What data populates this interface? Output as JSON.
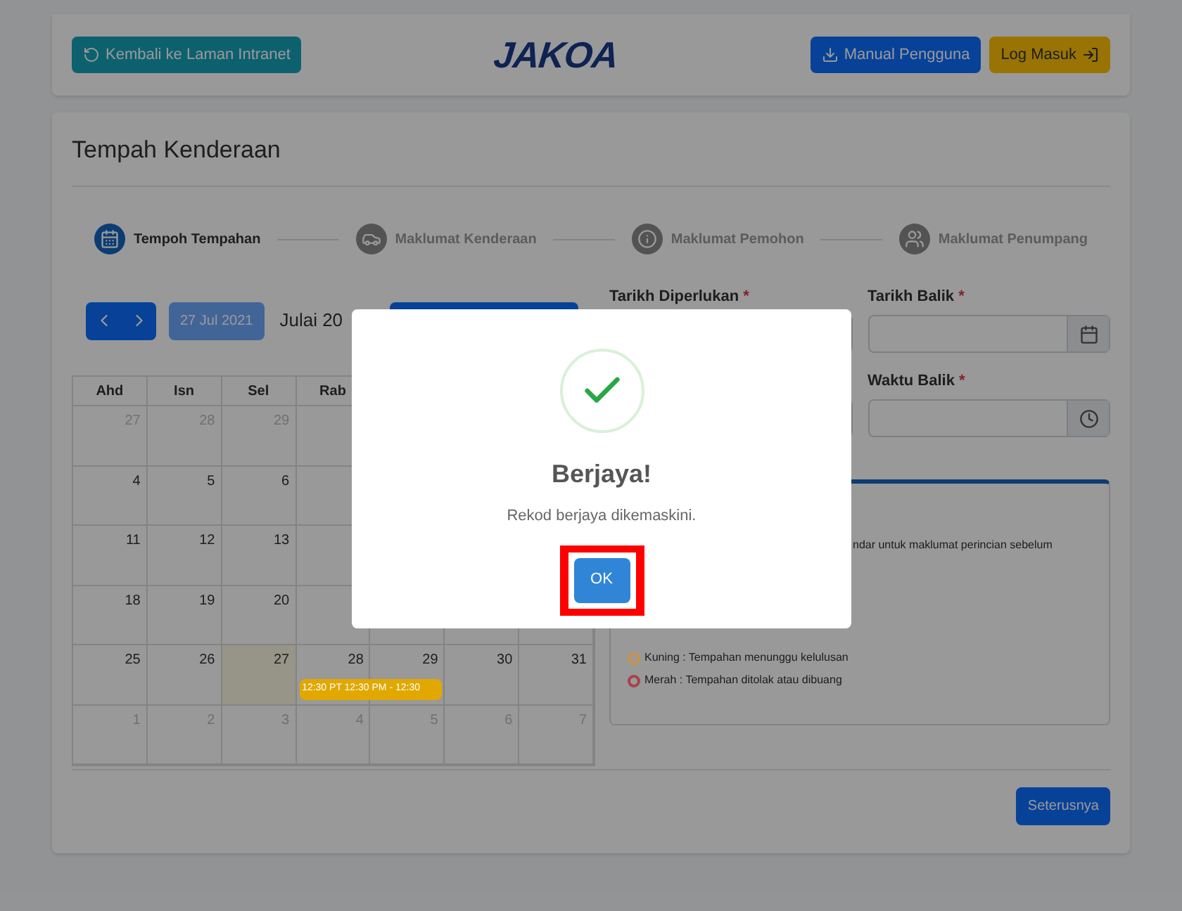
{
  "header": {
    "back_button": "Kembali ke Laman Intranet",
    "logo": "JAKOA",
    "manual_button": "Manual Pengguna",
    "login_button": "Log Masuk"
  },
  "card": {
    "title": "Tempah Kenderaan"
  },
  "steps": [
    {
      "label": "Tempoh Tempahan",
      "kind": "calendar",
      "selected": true
    },
    {
      "label": "Maklumat Kenderaan",
      "kind": "car",
      "selected": false
    },
    {
      "label": "Maklumat Pemohon",
      "kind": "info",
      "selected": false
    },
    {
      "label": "Maklumat Penumpang",
      "kind": "users",
      "selected": false
    }
  ],
  "calendar": {
    "today_button": "27 Jul 2021",
    "month_title": "Julai 20",
    "weekdays": [
      "Ahd",
      "Isn",
      "Sel",
      "Rab"
    ],
    "weeks": [
      {
        "days": [
          {
            "day": "27",
            "other_month": true,
            "today": false
          },
          {
            "day": "28",
            "other_month": true,
            "today": false
          },
          {
            "day": "29",
            "other_month": true,
            "today": false
          }
        ]
      },
      {
        "days": [
          {
            "day": "4",
            "other_month": false,
            "today": false
          },
          {
            "day": "5",
            "other_month": false,
            "today": false
          },
          {
            "day": "6",
            "other_month": false,
            "today": false
          }
        ]
      },
      {
        "days": [
          {
            "day": "11",
            "other_month": false,
            "today": false
          },
          {
            "day": "12",
            "other_month": false,
            "today": false
          },
          {
            "day": "13",
            "other_month": false,
            "today": false
          }
        ]
      },
      {
        "days": [
          {
            "day": "18",
            "other_month": false,
            "today": false
          },
          {
            "day": "19",
            "other_month": false,
            "today": false
          },
          {
            "day": "20",
            "other_month": false,
            "today": false
          }
        ]
      },
      {
        "days": [
          {
            "day": "25",
            "other_month": false,
            "today": false
          },
          {
            "day": "26",
            "other_month": false,
            "today": false
          },
          {
            "day": "27",
            "other_month": false,
            "today": true
          },
          {
            "day": "28",
            "other_month": false,
            "today": false,
            "event": "12:30 PT 12:30 PM - 12:30"
          },
          {
            "day": "29",
            "other_month": false,
            "today": false
          },
          {
            "day": "30",
            "other_month": false,
            "today": false
          },
          {
            "day": "31",
            "other_month": false,
            "today": false
          }
        ]
      },
      {
        "days": [
          {
            "day": "1",
            "other_month": true,
            "today": false
          },
          {
            "day": "2",
            "other_month": true,
            "today": false
          },
          {
            "day": "3",
            "other_month": true,
            "today": false
          },
          {
            "day": "4",
            "other_month": true,
            "today": false
          },
          {
            "day": "5",
            "other_month": true,
            "today": false
          },
          {
            "day": "6",
            "other_month": true,
            "today": false
          },
          {
            "day": "7",
            "other_month": true,
            "today": false
          }
        ]
      }
    ]
  },
  "form": {
    "fields": [
      {
        "label": "Tarikh Diperlukan",
        "required_mark": "*",
        "kind": "date"
      },
      {
        "label": "Tarikh Balik",
        "required_mark": "*",
        "kind": "date"
      },
      {
        "kind": "time"
      },
      {
        "label": "Waktu Balik",
        "required_mark": "*",
        "kind": "time"
      }
    ]
  },
  "legend": {
    "note": "ndar untuk maklumat perincian sebelum",
    "items": [
      {
        "label": "Kuning : Tempahan menunggu kelulusan",
        "color": "#c8924a"
      },
      {
        "label": "Merah : Tempahan ditolak atau dibuang",
        "color": "#a8424c"
      }
    ]
  },
  "footer": {
    "next_button": "Seterusnya"
  },
  "dialog": {
    "title": "Berjaya!",
    "message": "Rekod berjaya dikemaskini.",
    "ok_button": "OK",
    "highlighted": true
  }
}
